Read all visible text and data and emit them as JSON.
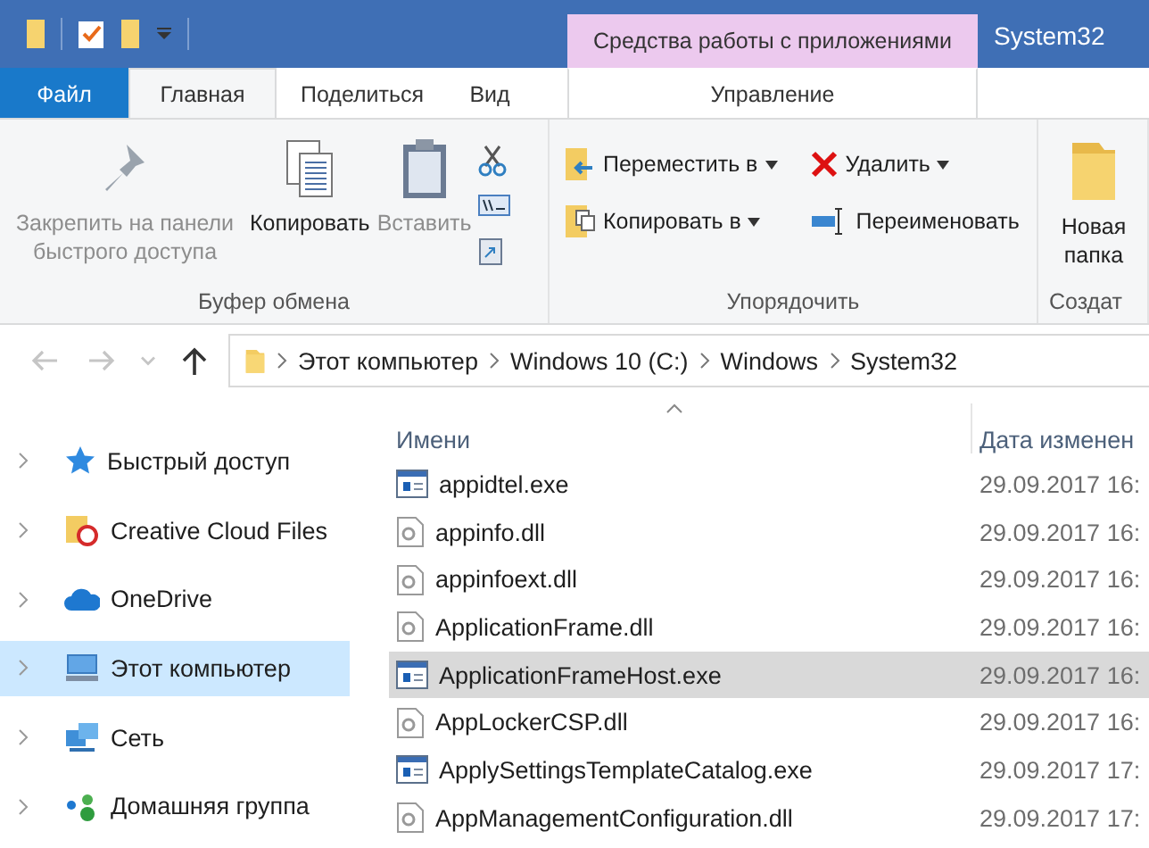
{
  "window": {
    "title": "System32",
    "context_group": "Средства работы с приложениями"
  },
  "tabs": [
    {
      "label": "Файл",
      "kind": "file",
      "selected": false
    },
    {
      "label": "Главная",
      "kind": "normal",
      "selected": true
    },
    {
      "label": "Поделиться",
      "kind": "normal",
      "selected": false
    },
    {
      "label": "Вид",
      "kind": "normal",
      "selected": false
    },
    {
      "label": "Управление",
      "kind": "context",
      "selected": false
    }
  ],
  "ribbon": {
    "groups": [
      {
        "label": "Буфер обмена",
        "buttons": [
          {
            "label": "Закрепить на панели быстрого доступа",
            "kind": "large",
            "disabled": true
          },
          {
            "label": "Копировать",
            "kind": "large",
            "disabled": false
          },
          {
            "label": "Вставить",
            "kind": "large",
            "disabled": true
          },
          {
            "kind": "icons"
          }
        ]
      },
      {
        "label": "Упорядочить",
        "buttons": [
          {
            "label": "Переместить в",
            "kind": "small",
            "has_menu": true
          },
          {
            "label": "Копировать в",
            "kind": "small",
            "has_menu": true
          },
          {
            "label": "Удалить",
            "kind": "small",
            "has_menu": true
          },
          {
            "label": "Переименовать",
            "kind": "small",
            "has_menu": false
          }
        ]
      },
      {
        "label": "Создат",
        "buttons": [
          {
            "label": "Новая папка",
            "kind": "large",
            "disabled": false
          }
        ]
      }
    ]
  },
  "address": {
    "back_disabled": true,
    "forward_disabled": true,
    "path": [
      "Этот компьютер",
      "Windows 10 (C:)",
      "Windows",
      "System32"
    ]
  },
  "sidebar": {
    "items": [
      {
        "label": "Быстрый доступ",
        "selected": false
      },
      {
        "label": "Creative Cloud Files",
        "selected": false
      },
      {
        "label": "OneDrive",
        "selected": false
      },
      {
        "label": "Этот компьютер",
        "selected": true
      },
      {
        "label": "Сеть",
        "selected": false
      },
      {
        "label": "Домашняя группа",
        "selected": false
      }
    ]
  },
  "table": {
    "columns": [
      "Имени",
      "Дата изменен"
    ],
    "rows": [
      {
        "name": "appidtel.exe",
        "date": "29.09.2017 16:",
        "kind": "exe",
        "selected": false
      },
      {
        "name": "appinfo.dll",
        "date": "29.09.2017 16:",
        "kind": "dll",
        "selected": false
      },
      {
        "name": "appinfoext.dll",
        "date": "29.09.2017 16:",
        "kind": "dll",
        "selected": false
      },
      {
        "name": "ApplicationFrame.dll",
        "date": "29.09.2017 16:",
        "kind": "dll",
        "selected": false
      },
      {
        "name": "ApplicationFrameHost.exe",
        "date": "29.09.2017 16:",
        "kind": "exe",
        "selected": true
      },
      {
        "name": "AppLockerCSP.dll",
        "date": "29.09.2017 16:",
        "kind": "dll",
        "selected": false
      },
      {
        "name": "ApplySettingsTemplateCatalog.exe",
        "date": "29.09.2017 17:",
        "kind": "exe",
        "selected": false
      },
      {
        "name": "AppManagementConfiguration.dll",
        "date": "29.09.2017 17:",
        "kind": "dll",
        "selected": false
      }
    ]
  }
}
